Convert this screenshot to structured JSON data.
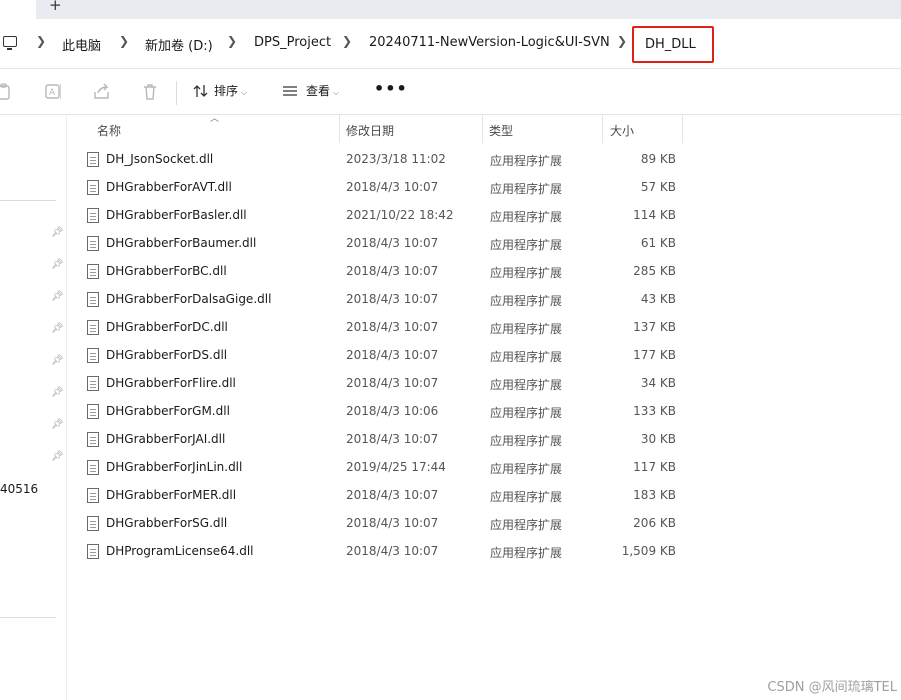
{
  "tabs": {
    "new_tab": "+"
  },
  "breadcrumb": {
    "items": [
      "此电脑",
      "新加卷 (D:)",
      "DPS_Project",
      "20240711-NewVersion-Logic&UI-SVN"
    ],
    "current": "DH_DLL"
  },
  "toolbar": {
    "sort_label": "排序",
    "view_label": "查看",
    "more_label": "•••"
  },
  "nav": {
    "partial_text": "40516"
  },
  "columns": {
    "name": "名称",
    "date": "修改日期",
    "type": "类型",
    "size": "大小"
  },
  "files": [
    {
      "name": "DH_JsonSocket.dll",
      "date": "2023/3/18 11:02",
      "type": "应用程序扩展",
      "size": "89 KB"
    },
    {
      "name": "DHGrabberForAVT.dll",
      "date": "2018/4/3 10:07",
      "type": "应用程序扩展",
      "size": "57 KB"
    },
    {
      "name": "DHGrabberForBasler.dll",
      "date": "2021/10/22 18:42",
      "type": "应用程序扩展",
      "size": "114 KB"
    },
    {
      "name": "DHGrabberForBaumer.dll",
      "date": "2018/4/3 10:07",
      "type": "应用程序扩展",
      "size": "61 KB"
    },
    {
      "name": "DHGrabberForBC.dll",
      "date": "2018/4/3 10:07",
      "type": "应用程序扩展",
      "size": "285 KB"
    },
    {
      "name": "DHGrabberForDalsaGige.dll",
      "date": "2018/4/3 10:07",
      "type": "应用程序扩展",
      "size": "43 KB"
    },
    {
      "name": "DHGrabberForDC.dll",
      "date": "2018/4/3 10:07",
      "type": "应用程序扩展",
      "size": "137 KB"
    },
    {
      "name": "DHGrabberForDS.dll",
      "date": "2018/4/3 10:07",
      "type": "应用程序扩展",
      "size": "177 KB"
    },
    {
      "name": "DHGrabberForFlire.dll",
      "date": "2018/4/3 10:07",
      "type": "应用程序扩展",
      "size": "34 KB"
    },
    {
      "name": "DHGrabberForGM.dll",
      "date": "2018/4/3 10:06",
      "type": "应用程序扩展",
      "size": "133 KB"
    },
    {
      "name": "DHGrabberForJAI.dll",
      "date": "2018/4/3 10:07",
      "type": "应用程序扩展",
      "size": "30 KB"
    },
    {
      "name": "DHGrabberForJinLin.dll",
      "date": "2019/4/25 17:44",
      "type": "应用程序扩展",
      "size": "117 KB"
    },
    {
      "name": "DHGrabberForMER.dll",
      "date": "2018/4/3 10:07",
      "type": "应用程序扩展",
      "size": "183 KB"
    },
    {
      "name": "DHGrabberForSG.dll",
      "date": "2018/4/3 10:07",
      "type": "应用程序扩展",
      "size": "206 KB"
    },
    {
      "name": "DHProgramLicense64.dll",
      "date": "2018/4/3 10:07",
      "type": "应用程序扩展",
      "size": "1,509 KB"
    }
  ],
  "watermark": "CSDN @风间琉璃TEL",
  "colors": {
    "highlight_border": "#e0201b"
  }
}
